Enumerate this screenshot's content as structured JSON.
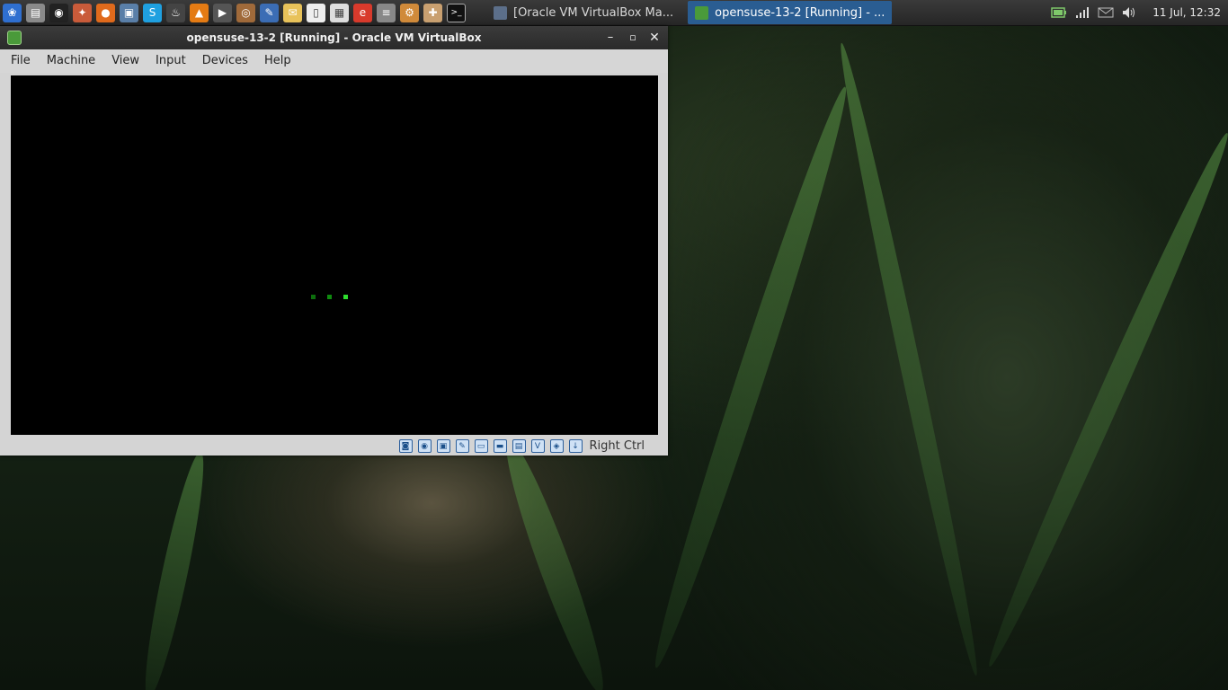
{
  "launchers": [
    {
      "name": "kde-menu-icon",
      "glyph": "❀",
      "color": "#2f6fd0"
    },
    {
      "name": "file-manager-icon",
      "glyph": "▤",
      "color": "#8a8a8a"
    },
    {
      "name": "music-player-icon",
      "glyph": "◉",
      "color": "#222222"
    },
    {
      "name": "paint-icon",
      "glyph": "✦",
      "color": "#c95b3a"
    },
    {
      "name": "firefox-icon",
      "glyph": "●",
      "color": "#e06a1c"
    },
    {
      "name": "screenshot-tool-icon",
      "glyph": "▣",
      "color": "#5a7fa8"
    },
    {
      "name": "skype-icon",
      "glyph": "S",
      "color": "#1fa0e0"
    },
    {
      "name": "steam-icon",
      "glyph": "♨",
      "color": "#444444"
    },
    {
      "name": "vlc-icon",
      "glyph": "▲",
      "color": "#e47b14"
    },
    {
      "name": "video-player-icon",
      "glyph": "▶",
      "color": "#555555"
    },
    {
      "name": "audio-icon",
      "glyph": "◎",
      "color": "#a06a3a"
    },
    {
      "name": "inkscape-icon",
      "glyph": "✎",
      "color": "#3b6db5"
    },
    {
      "name": "notes-icon",
      "glyph": "✉",
      "color": "#e8c25a"
    },
    {
      "name": "text-editor-icon",
      "glyph": "▯",
      "color": "#eeeeee"
    },
    {
      "name": "spreadsheet-icon",
      "glyph": "▦",
      "color": "#dddddd"
    },
    {
      "name": "pdf-reader-icon",
      "glyph": "e",
      "color": "#d83a2c"
    },
    {
      "name": "mixer-icon",
      "glyph": "≡",
      "color": "#888888"
    },
    {
      "name": "settings-icon",
      "glyph": "⚙",
      "color": "#d08a3a"
    },
    {
      "name": "software-center-icon",
      "glyph": "✚",
      "color": "#c9a070"
    },
    {
      "name": "terminal-icon",
      "glyph": ">_",
      "color": "#111111"
    }
  ],
  "tasks": [
    {
      "label": "[Oracle VM VirtualBox Ma...",
      "active": false,
      "icon_color": "#5c6f8a"
    },
    {
      "label": "opensuse-13-2 [Running] - ...",
      "active": true,
      "icon_color": "#4a9a3a"
    }
  ],
  "tray": {
    "icons": [
      "battery-icon",
      "network-signal-icon",
      "mail-icon",
      "volume-icon"
    ],
    "clock": "11 Jul, 12:32"
  },
  "window": {
    "title": "opensuse-13-2 [Running] - Oracle VM VirtualBox",
    "menu": [
      "File",
      "Machine",
      "View",
      "Input",
      "Devices",
      "Help"
    ],
    "loading_dots": [
      "#0d6e0d",
      "#0f8a0f",
      "#2ede2e"
    ],
    "status_icons": [
      {
        "name": "hard-disk-status-icon",
        "glyph": "◙"
      },
      {
        "name": "optical-drive-status-icon",
        "glyph": "◉"
      },
      {
        "name": "audio-status-icon",
        "glyph": "▣"
      },
      {
        "name": "network-status-icon",
        "glyph": "✎"
      },
      {
        "name": "usb-status-icon",
        "glyph": "▭"
      },
      {
        "name": "shared-folders-status-icon",
        "glyph": "▬"
      },
      {
        "name": "display-status-icon",
        "glyph": "▤"
      },
      {
        "name": "video-capture-status-icon",
        "glyph": "V"
      },
      {
        "name": "virtualization-status-icon",
        "glyph": "◈"
      },
      {
        "name": "mouse-integration-status-icon",
        "glyph": "↓"
      }
    ],
    "host_key": "Right Ctrl"
  }
}
